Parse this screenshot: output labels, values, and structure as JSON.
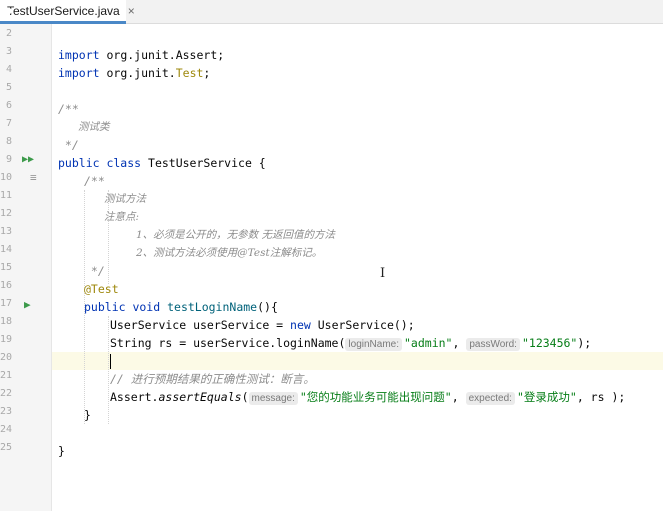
{
  "editor": {
    "tab": {
      "title": "TestUserService.java",
      "close": "×"
    },
    "line_numbers": [
      "2",
      "3",
      "4",
      "5",
      "6",
      "7",
      "8",
      "9",
      "10",
      "11",
      "12",
      "13",
      "14",
      "15",
      "16",
      "17",
      "18",
      "19",
      "20",
      "21",
      "22",
      "23",
      "24",
      "25"
    ],
    "code": {
      "import1_kw": "import",
      "import1_pkg": " org.junit.Assert;",
      "import2_kw": "import",
      "import2_pkg": " org.junit.",
      "import2_cls": "Test",
      "import2_end": ";",
      "doc_open": "/**",
      "doc_class": "测试类",
      "doc_close": " */",
      "class_kw": "public class",
      "class_name": " TestUserService {",
      "mdoc_open": "/**",
      "mdoc_1": "测试方法",
      "mdoc_2": "注意点:",
      "mdoc_3": "1、必须是公开的，无参数 无返回值的方法",
      "mdoc_4": "2、测试方法必须使用@Test注解标记。",
      "mdoc_close": " */",
      "annotation": "@Test",
      "method_kw": "public void",
      "method_name": " testLoginName",
      "method_end": "(){",
      "l18_a": "UserService userService = ",
      "l18_new": "new",
      "l18_b": " UserService();",
      "l19_a": "String rs = userService.loginName(",
      "l19_hint1": "loginName:",
      "l19_str1": "\"admin\"",
      "l19_comma": ",",
      "l19_hint2": "passWord:",
      "l19_str2": "\"123456\"",
      "l19_end": ");",
      "comment21": "// 进行预期结果的正确性测试：断言。",
      "l22_a": "Assert.",
      "l22_fn": "assertEquals",
      "l22_paren": "(",
      "l22_hint1": "message:",
      "l22_str1": "\"您的功能业务可能出现问题\"",
      "l22_comma": ",",
      "l22_hint2": "expected:",
      "l22_str2": "\"登录成功\"",
      "l22_end": ", rs );",
      "close_method": "}",
      "close_class": "}"
    },
    "icons": {
      "run_class": "run-all-icon",
      "run_method": "run-icon",
      "fold": "fold-icon"
    },
    "colors": {
      "keyword": "#0033b3",
      "string": "#067d17",
      "comment": "#8c8c8c",
      "annotation": "#9e880d",
      "current_line": "#fcfae6"
    }
  }
}
